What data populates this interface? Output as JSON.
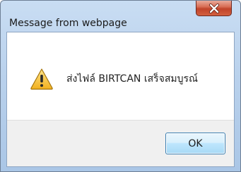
{
  "window": {
    "title": "Message from webpage",
    "close_icon": "close-x-icon"
  },
  "content": {
    "icon": "warning-triangle-icon",
    "message": "ส่งไฟล์ BIRTCAN เสร็จสมบูรณ์"
  },
  "buttons": {
    "ok_label": "OK"
  },
  "colors": {
    "close_button": "#c9462c",
    "title_bar": "#b9d1ec",
    "ok_button_border": "#3c7fb1",
    "warning_fill": "#f7c948"
  }
}
